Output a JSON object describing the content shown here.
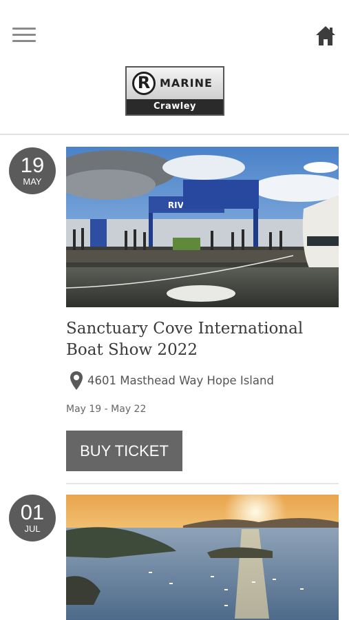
{
  "header": {
    "logo": {
      "mark": "R",
      "word": "MARINE",
      "subtitle": "Crawley"
    }
  },
  "events": [
    {
      "day": "19",
      "month": "MAY",
      "title_line1": "Sanctuary Cove International",
      "title_line2": "Boat Show 2022",
      "address": "4601 Masthead Way Hope Island",
      "dates": "May 19 - May 22",
      "button_label": "BUY TICKET",
      "banner_text": "RIVIERA"
    },
    {
      "day": "01",
      "month": "JUL"
    }
  ],
  "colors": {
    "badge": "#5b5b5b",
    "button": "#666666",
    "text_dark": "#3a3a3a",
    "accent_blue": "#2d4ea3"
  },
  "icons": {
    "menu": "hamburger-menu-icon",
    "home": "home-icon",
    "location": "map-pin-icon"
  }
}
